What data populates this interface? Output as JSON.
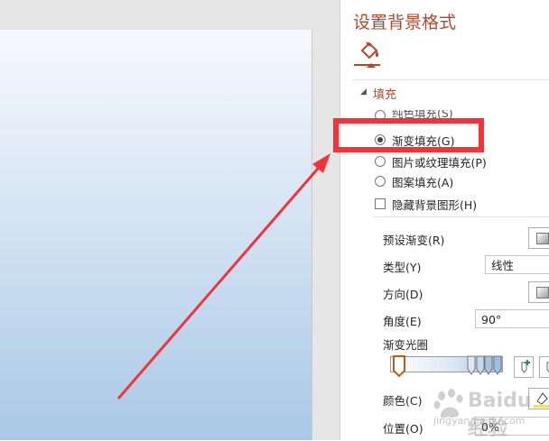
{
  "pane": {
    "title": "设置背景格式",
    "section_title": "填充",
    "options": {
      "solid": "纯色填充(S)",
      "gradient": "渐变填充(G)",
      "picture": "图片或纹理填充(P)",
      "pattern": "图案填充(A)",
      "hide_graphics": "隐藏背景图形(H)"
    },
    "selected_option": "gradient",
    "preset_label": "预设渐变(R)",
    "type_label": "类型(Y)",
    "type_value": "线性",
    "direction_label": "方向(D)",
    "angle_label": "角度(E)",
    "angle_value": "90°",
    "stops_label": "渐变光圈",
    "color_label": "颜色(C)",
    "position_label": "位置(O)",
    "position_value": "0%"
  },
  "colors": {
    "accent": "#b7472a",
    "annotation": "#f0343a",
    "slide_top": "#f6f9fd",
    "slide_bottom": "#a9c8e6"
  },
  "icons": [
    "paint-bucket-icon",
    "add-stop-icon",
    "remove-stop-icon",
    "font-color-icon"
  ],
  "watermark": {
    "brand": "Baidu经验",
    "url": "jingyan.baidu.com"
  }
}
